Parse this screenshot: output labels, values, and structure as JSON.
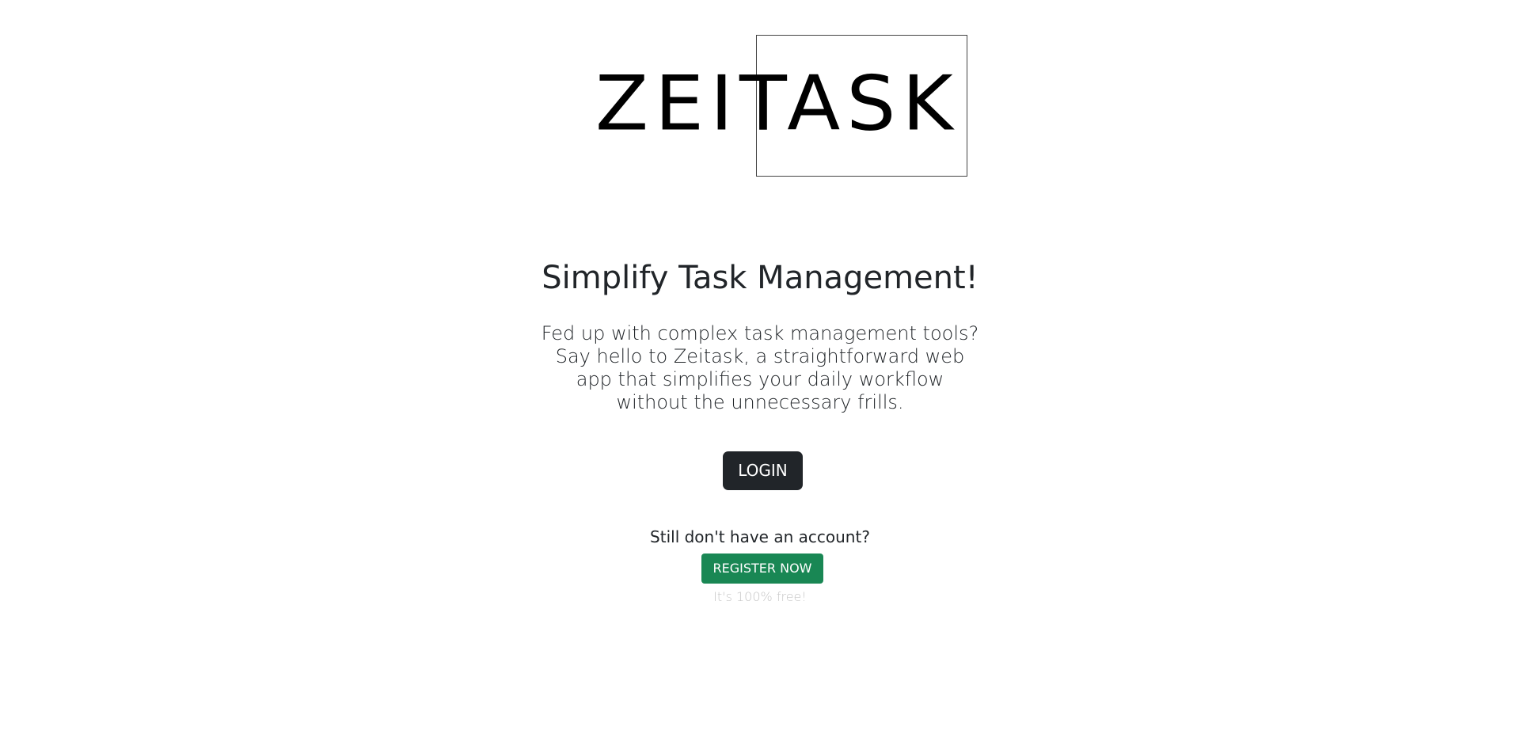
{
  "logo": {
    "text": "ZEITASK"
  },
  "hero": {
    "headline": "Simplify Task Management!",
    "lead": "Fed up with complex task management tools? Say hello to Zeitask, a straightforward web app that simplifies your daily workflow without the unnecessary frills."
  },
  "actions": {
    "login_label": "LOGIN",
    "register_prompt": "Still don't have an account?",
    "register_label": "REGISTER NOW",
    "free_note": "It's 100% free!"
  },
  "colors": {
    "login_bg": "#212529",
    "register_bg": "#198754",
    "note_text": "#c7c7c7"
  }
}
